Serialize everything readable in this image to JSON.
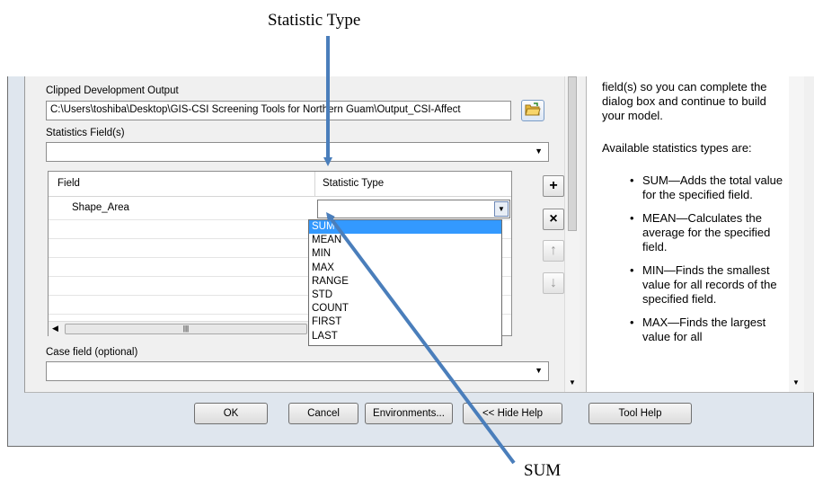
{
  "annotations": {
    "top_label": "Statistic Type",
    "bottom_label": "SUM"
  },
  "form": {
    "output_label": "Clipped Development Output",
    "output_value": "C:\\Users\\toshiba\\Desktop\\GIS-CSI Screening Tools for Northern Guam\\Output_CSI-Affect",
    "stats_field_label": "Statistics Field(s)",
    "stats_field_value": "",
    "case_field_label": "Case field (optional)",
    "case_field_value": ""
  },
  "grid": {
    "col_field": "Field",
    "col_stat": "Statistic Type",
    "row_field": "Shape_Area",
    "row_stat": ""
  },
  "dropdown": {
    "options": [
      "SUM",
      "MEAN",
      "MIN",
      "MAX",
      "RANGE",
      "STD",
      "COUNT",
      "FIRST",
      "LAST"
    ],
    "selected": "SUM"
  },
  "side_buttons": {
    "add": "+",
    "remove": "×",
    "up": "↑",
    "down": "↓"
  },
  "help": {
    "intro": "field(s) so you can complete the dialog box and continue to build your model.",
    "available": "Available statistics types are:",
    "items": [
      "SUM—Adds the total value for the specified field.",
      "MEAN—Calculates the average for the specified field.",
      "MIN—Finds the smallest value for all records of the specified field.",
      "MAX—Finds the largest value for all"
    ]
  },
  "buttons": {
    "ok": "OK",
    "cancel": "Cancel",
    "environments": "Environments...",
    "hide_help": "<< Hide Help",
    "tool_help": "Tool Help"
  },
  "colors": {
    "arrow": "#4a7ebb",
    "selection": "#3399ff"
  }
}
